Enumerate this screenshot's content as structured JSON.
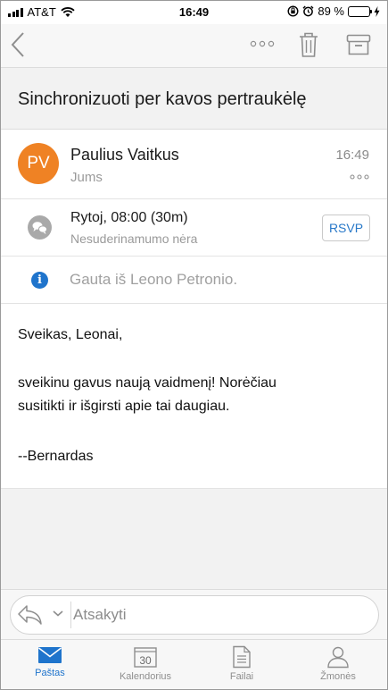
{
  "status_bar": {
    "carrier": "AT&T",
    "time": "16:49",
    "battery_percent": "89 %",
    "battery_level": 0.89,
    "battery_color": "#4cd964"
  },
  "message": {
    "subject": "Sinchronizuoti per kavos pertraukėlę",
    "sender": {
      "initials": "PV",
      "name": "Paulius Vaitkus",
      "to": "Jums",
      "time": "16:49",
      "avatar_color": "#ef8224"
    },
    "meeting": {
      "title": "Rytoj, 08:00 (30m)",
      "subtitle": "Nesuderinamumo nėra",
      "rsvp_label": "RSVP"
    },
    "info": {
      "text": "Gauta iš Leono Petronio."
    },
    "body": {
      "greeting": "Sveikas, Leonai,",
      "line1": "sveikinu gavus naują vaidmenį! Norėčiau",
      "line2": "susitikti ir išgirsti apie tai daugiau.",
      "signature": "--Bernardas"
    }
  },
  "reply": {
    "placeholder": "Atsakyti"
  },
  "tabs": [
    {
      "label": "Paštas",
      "icon": "mail-icon",
      "active": true
    },
    {
      "label": "Kalendorius",
      "icon": "calendar-icon",
      "active": false,
      "day": "30"
    },
    {
      "label": "Failai",
      "icon": "files-icon",
      "active": false
    },
    {
      "label": "Žmonės",
      "icon": "people-icon",
      "active": false
    }
  ],
  "colors": {
    "accent": "#1f74cc",
    "info": "#1f74cc",
    "rsvp_text": "#2878c8"
  }
}
